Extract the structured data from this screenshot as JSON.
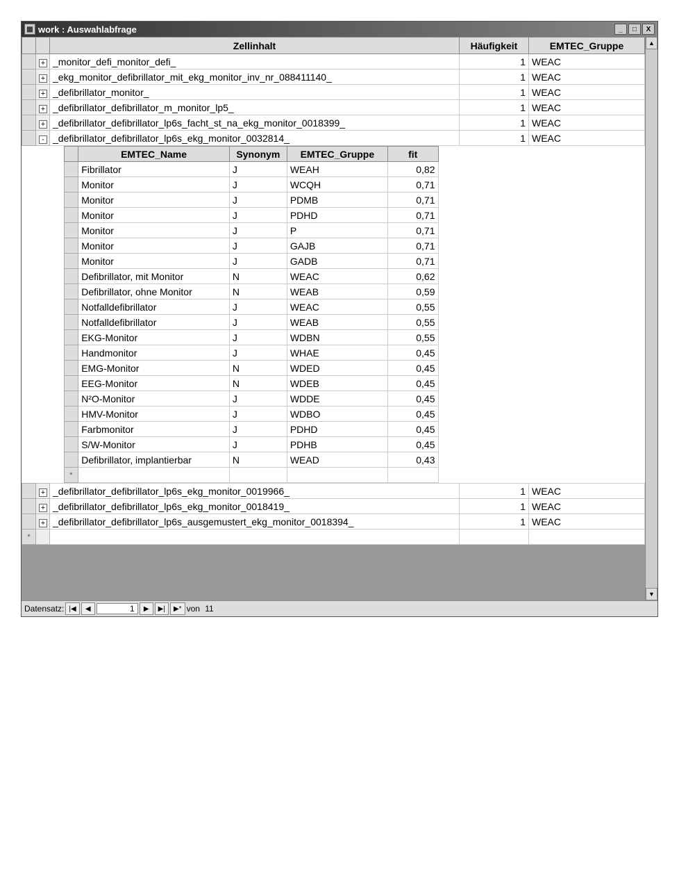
{
  "window": {
    "title": "work : Auswahlabfrage"
  },
  "main": {
    "headers": {
      "zellinhalt": "Zellinhalt",
      "haeufigkeit": "Häufigkeit",
      "emtec_gruppe": "EMTEC_Gruppe"
    },
    "rows": [
      {
        "exp": "+",
        "zell": "_monitor_defi_monitor_defi_",
        "hau": "1",
        "grp": "WEAC"
      },
      {
        "exp": "+",
        "zell": "_ekg_monitor_defibrillator_mit_ekg_monitor_inv_nr_088411140_",
        "hau": "1",
        "grp": "WEAC"
      },
      {
        "exp": "+",
        "zell": "_defibrillator_monitor_",
        "hau": "1",
        "grp": "WEAC"
      },
      {
        "exp": "+",
        "zell": "_defibrillator_defibrillator_m_monitor_lp5_",
        "hau": "1",
        "grp": "WEAC"
      },
      {
        "exp": "+",
        "zell": "_defibrillator_defibrillator_lp6s_facht_st_na_ekg_monitor_0018399_",
        "hau": "1",
        "grp": "WEAC"
      },
      {
        "exp": "-",
        "zell": "_defibrillator_defibrillator_lp6s_ekg_monitor_0032814_",
        "hau": "1",
        "grp": "WEAC"
      },
      {
        "exp": "+",
        "zell": "_defibrillator_defibrillator_lp6s_ekg_monitor_0019966_",
        "hau": "1",
        "grp": "WEAC"
      },
      {
        "exp": "+",
        "zell": "_defibrillator_defibrillator_lp6s_ekg_monitor_0018419_",
        "hau": "1",
        "grp": "WEAC"
      },
      {
        "exp": "+",
        "zell": "_defibrillator_defibrillator_lp6s_ausgemustert_ekg_monitor_0018394_",
        "hau": "1",
        "grp": "WEAC"
      }
    ],
    "newRowMarker": "*"
  },
  "sub": {
    "headers": {
      "name": "EMTEC_Name",
      "syn": "Synonym",
      "grp": "EMTEC_Gruppe",
      "fit": "fit"
    },
    "rows": [
      {
        "name": "Fibrillator",
        "syn": "J",
        "grp": "WEAH",
        "fit": "0,82"
      },
      {
        "name": "Monitor",
        "syn": "J",
        "grp": "WCQH",
        "fit": "0,71"
      },
      {
        "name": "Monitor",
        "syn": "J",
        "grp": "PDMB",
        "fit": "0,71"
      },
      {
        "name": "Monitor",
        "syn": "J",
        "grp": "PDHD",
        "fit": "0,71"
      },
      {
        "name": "Monitor",
        "syn": "J",
        "grp": "P",
        "fit": "0,71"
      },
      {
        "name": "Monitor",
        "syn": "J",
        "grp": "GAJB",
        "fit": "0,71"
      },
      {
        "name": "Monitor",
        "syn": "J",
        "grp": "GADB",
        "fit": "0,71"
      },
      {
        "name": "Defibrillator, mit Monitor",
        "syn": "N",
        "grp": "WEAC",
        "fit": "0,62"
      },
      {
        "name": "Defibrillator, ohne Monitor",
        "syn": "N",
        "grp": "WEAB",
        "fit": "0,59"
      },
      {
        "name": "Notfalldefibrillator",
        "syn": "J",
        "grp": "WEAC",
        "fit": "0,55"
      },
      {
        "name": "Notfalldefibrillator",
        "syn": "J",
        "grp": "WEAB",
        "fit": "0,55"
      },
      {
        "name": "EKG-Monitor",
        "syn": "J",
        "grp": "WDBN",
        "fit": "0,55"
      },
      {
        "name": "Handmonitor",
        "syn": "J",
        "grp": "WHAE",
        "fit": "0,45"
      },
      {
        "name": "EMG-Monitor",
        "syn": "N",
        "grp": "WDED",
        "fit": "0,45"
      },
      {
        "name": "EEG-Monitor",
        "syn": "N",
        "grp": "WDEB",
        "fit": "0,45"
      },
      {
        "name": "N²O-Monitor",
        "syn": "J",
        "grp": "WDDE",
        "fit": "0,45"
      },
      {
        "name": "HMV-Monitor",
        "syn": "J",
        "grp": "WDBO",
        "fit": "0,45"
      },
      {
        "name": "Farbmonitor",
        "syn": "J",
        "grp": "PDHD",
        "fit": "0,45"
      },
      {
        "name": "S/W-Monitor",
        "syn": "J",
        "grp": "PDHB",
        "fit": "0,45"
      },
      {
        "name": "Defibrillator, implantierbar",
        "syn": "N",
        "grp": "WEAD",
        "fit": "0,43"
      }
    ],
    "newRowMarker": "*"
  },
  "status": {
    "label": "Datensatz:",
    "first": "|◀",
    "prev": "◀",
    "current": "1",
    "next": "▶",
    "last": "▶|",
    "new": "▶*",
    "of_label": "von",
    "total": "11"
  },
  "winbtns": {
    "min": "_",
    "max": "□",
    "close": "X"
  }
}
